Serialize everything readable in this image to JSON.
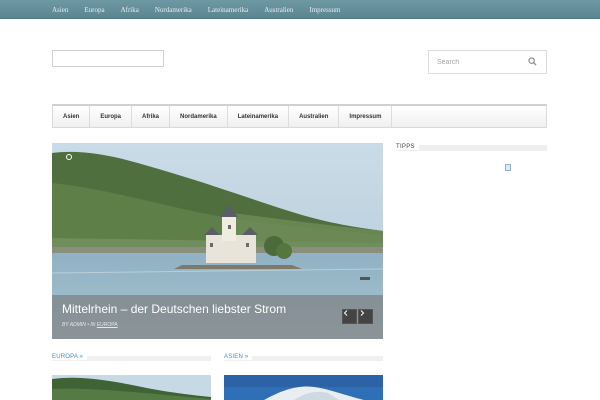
{
  "topnav": {
    "items": [
      "Asien",
      "Europa",
      "Afrika",
      "Nordamerika",
      "Lateinamerika",
      "Australien",
      "Impressum"
    ]
  },
  "search": {
    "placeholder": "Search"
  },
  "mainnav": {
    "items": [
      "Asien",
      "Europa",
      "Afrika",
      "Nordamerika",
      "Lateinamerika",
      "Australien",
      "Impressum"
    ]
  },
  "slider": {
    "title": "Mittelrhein – der Deutschen liebster Strom",
    "meta_prefix": "BY ADMIN • IN ",
    "category": "EUROPA"
  },
  "sidebar": {
    "title": "TIPPS"
  },
  "sections": [
    {
      "label": "EUROPA »"
    },
    {
      "label": "ASIEN »"
    }
  ],
  "colors": {
    "topbar": "#6f98a5",
    "link": "#3d8fc4",
    "caption_bg": "#787878"
  }
}
